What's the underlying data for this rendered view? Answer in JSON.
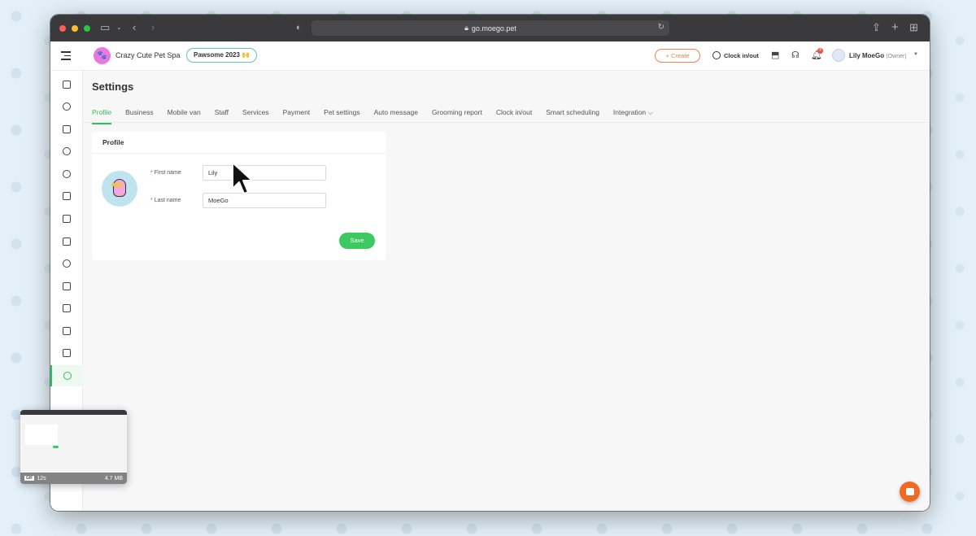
{
  "browser": {
    "url": "go.moego.pet"
  },
  "topbar": {
    "business_initial": "🐾",
    "business_name": "Crazy Cute Pet Spa",
    "promo_badge": "Pawsome 2023 🙌",
    "create_label": "+ Create",
    "clock_label": "Clock in/out",
    "notification_count": "4",
    "user_name": "Lily MoeGo",
    "user_role": "(Owner)"
  },
  "sidebar": {
    "items": [
      {
        "icon": "calendar-icon"
      },
      {
        "icon": "pet-icon"
      },
      {
        "icon": "clipboard-icon"
      },
      {
        "icon": "chat-icon"
      },
      {
        "icon": "alarm-icon"
      },
      {
        "icon": "schedule-icon"
      },
      {
        "icon": "contact-card-icon"
      },
      {
        "icon": "document-icon"
      },
      {
        "icon": "dollar-icon"
      },
      {
        "icon": "megaphone-icon"
      },
      {
        "icon": "basket-icon"
      },
      {
        "icon": "inbox-icon"
      },
      {
        "icon": "bar-chart-icon"
      },
      {
        "icon": "gear-icon",
        "active": true
      }
    ]
  },
  "main": {
    "title": "Settings",
    "tabs": [
      {
        "label": "Profile",
        "active": true
      },
      {
        "label": "Business"
      },
      {
        "label": "Mobile van"
      },
      {
        "label": "Staff"
      },
      {
        "label": "Services"
      },
      {
        "label": "Payment"
      },
      {
        "label": "Pet settings"
      },
      {
        "label": "Auto message"
      },
      {
        "label": "Grooming report"
      },
      {
        "label": "Clock in/out"
      },
      {
        "label": "Smart scheduling"
      },
      {
        "label": "Integration ⌵"
      }
    ],
    "profile_card": {
      "header": "Profile",
      "first_name_label": "First name",
      "first_name_value": "Lily",
      "last_name_label": "Last name",
      "last_name_value": "MoeGo",
      "required_mark": "*",
      "save_label": "Save"
    }
  },
  "recording_thumbnail": {
    "duration": "12s",
    "size": "4.7 MB",
    "badge": "GIF"
  },
  "colors": {
    "accent_green": "#30c05a",
    "create_orange": "#f0824b",
    "chat_orange": "#f06a24"
  }
}
